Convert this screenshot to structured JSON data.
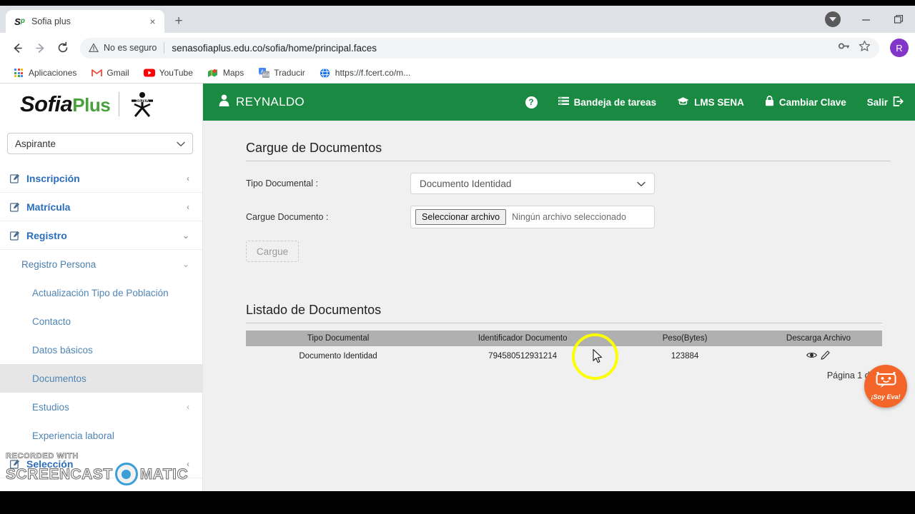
{
  "browser": {
    "tab": {
      "title": "Sofia plus",
      "favicon_s": "S",
      "favicon_p": "p",
      "close_icon": "×"
    },
    "newtab_label": "+",
    "window_controls": {
      "minimize": "—",
      "restore": "❐"
    },
    "nav": {
      "back": "←",
      "forward": "→",
      "reload": "⟳"
    },
    "omnibox": {
      "security_icon": "warning-triangle-icon",
      "security_text": "No es seguro",
      "url": "senasofiaplus.edu.co/sofia/home/principal.faces",
      "key_icon": "key-icon",
      "star_icon": "star-icon",
      "avatar_initial": "R",
      "avatar_color": "#8334c9"
    },
    "bookmarks": [
      {
        "label": "Aplicaciones",
        "icon": "apps-grid-icon"
      },
      {
        "label": "Gmail",
        "icon": "gmail-icon"
      },
      {
        "label": "YouTube",
        "icon": "youtube-icon"
      },
      {
        "label": "Maps",
        "icon": "maps-icon"
      },
      {
        "label": "Traducir",
        "icon": "translate-icon"
      },
      {
        "label": "https://f.fcert.co/m...",
        "icon": "globe-icon"
      }
    ]
  },
  "sidebar": {
    "brand": {
      "sofia": "Sofia",
      "plus": "Plus",
      "sena": "SENA"
    },
    "role_select": {
      "value": "Aspirante",
      "chevron": "⌄"
    },
    "menu": [
      {
        "label": "Inscripción",
        "level": 0,
        "chevron": "‹",
        "active": false
      },
      {
        "label": "Matrícula",
        "level": 0,
        "chevron": "‹",
        "active": false
      },
      {
        "label": "Registro",
        "level": 0,
        "chevron": "⌄",
        "active": false
      },
      {
        "label": "Registro Persona",
        "level": 1,
        "chevron": "⌄",
        "active": false
      },
      {
        "label": "Actualización Tipo de Población",
        "level": 2,
        "chevron": "",
        "active": false
      },
      {
        "label": "Contacto",
        "level": 2,
        "chevron": "",
        "active": false
      },
      {
        "label": "Datos básicos",
        "level": 2,
        "chevron": "",
        "active": false
      },
      {
        "label": "Documentos",
        "level": 2,
        "chevron": "",
        "active": true
      },
      {
        "label": "Estudios",
        "level": 2,
        "chevron": "‹",
        "active": false
      },
      {
        "label": "Experiencia laboral",
        "level": 2,
        "chevron": "",
        "active": false
      },
      {
        "label": "Selección",
        "level": 0,
        "chevron": "‹",
        "active": false
      }
    ]
  },
  "header": {
    "user_name": "REYNALDO",
    "user_icon": "user-icon",
    "help_icon_label": "?",
    "nav_items": [
      {
        "label": "Bandeja de tareas",
        "icon": "tasks-icon"
      },
      {
        "label": "LMS SENA",
        "icon": "graduation-cap-icon"
      },
      {
        "label": "Cambiar Clave",
        "icon": "lock-icon"
      },
      {
        "label": "Salir",
        "icon": "exit-icon"
      }
    ],
    "accent_color": "#1a8a42"
  },
  "main": {
    "upload_section_title": "Cargue de Documentos",
    "fields": {
      "tipo_documental_label": "Tipo Documental :",
      "tipo_documental_value": "Documento Identidad",
      "cargue_documento_label": "Cargue Documento :",
      "file_button_label": "Seleccionar archivo",
      "file_status_text": "Ningún archivo seleccionado"
    },
    "submit_button_label": "Cargue",
    "list_section_title": "Listado de Documentos",
    "table": {
      "columns": [
        "Tipo Documental",
        "Identificador Documento",
        "Peso(Bytes)",
        "Descarga Archivo"
      ],
      "rows": [
        {
          "tipo_documental": "Documento Identidad",
          "identificador": "794580512931214",
          "peso": "123884",
          "acciones": [
            "view-eye-icon",
            "edit-pencil-icon"
          ]
        }
      ]
    },
    "pagination_text": "Página 1 de 1"
  },
  "eva_widget": {
    "label": "¡Soy Eva!",
    "color": "#f4652a",
    "icon": "robot-face-icon"
  },
  "watermark": {
    "line1": "RECORDED WITH",
    "word1": "SCREENCAST",
    "word2": "MATIC"
  }
}
